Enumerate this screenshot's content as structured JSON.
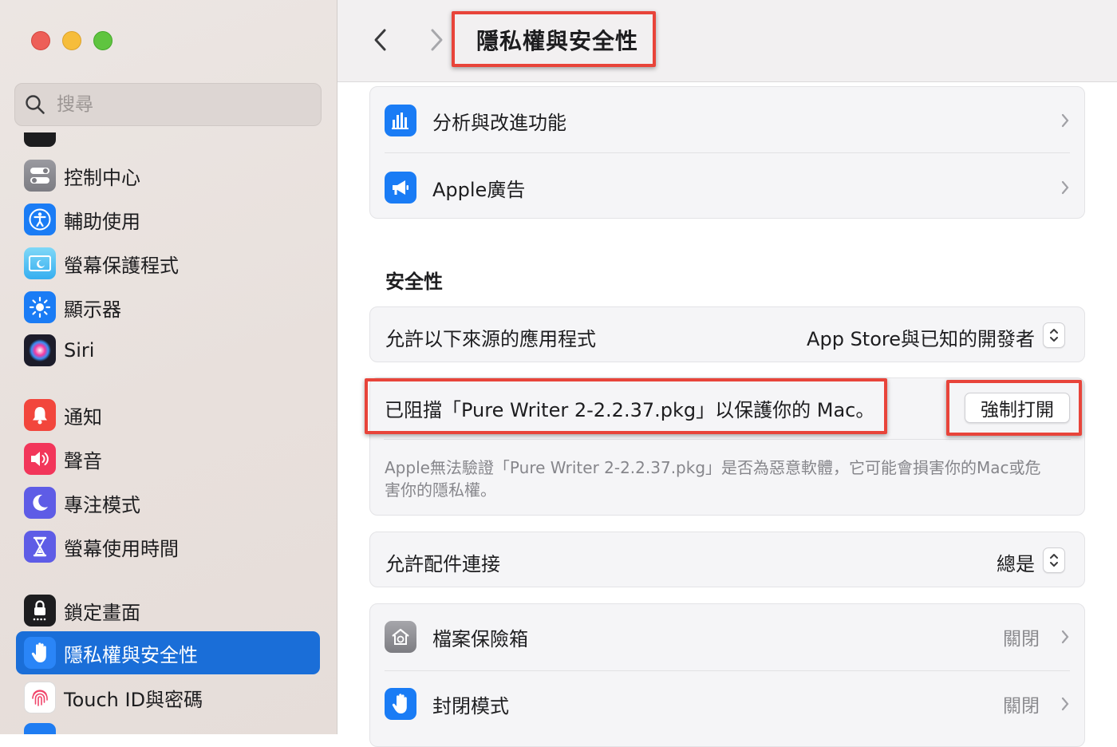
{
  "window": {
    "title": "隱私權與安全性"
  },
  "sidebar": {
    "search": {
      "placeholder": "搜尋"
    },
    "items": [
      {
        "label": "控制中心",
        "icon": "control-center-icon",
        "color": "#8e8e93"
      },
      {
        "label": "輔助使用",
        "icon": "accessibility-icon",
        "color": "#1a7cf5"
      },
      {
        "label": "螢幕保護程式",
        "icon": "screen-saver-icon",
        "color": "#5ac8fa"
      },
      {
        "label": "顯示器",
        "icon": "display-brightness-icon",
        "color": "#1a7cf5"
      },
      {
        "label": "Siri",
        "icon": "siri-icon",
        "color": "#2b2b3a"
      },
      {
        "label": "通知",
        "icon": "notification-bell-icon",
        "color": "#f2463c"
      },
      {
        "label": "聲音",
        "icon": "speaker-icon",
        "color": "#f2365a"
      },
      {
        "label": "專注模式",
        "icon": "moon-icon",
        "color": "#5e5ce6"
      },
      {
        "label": "螢幕使用時間",
        "icon": "hourglass-icon",
        "color": "#5e5ce6"
      },
      {
        "label": "鎖定畫面",
        "icon": "lock-screen-icon",
        "color": "#1d1d1f"
      },
      {
        "label": "隱私權與安全性",
        "icon": "hand-icon",
        "color": "#1a7cf5",
        "active": true
      },
      {
        "label": "Touch ID與密碼",
        "icon": "fingerprint-icon",
        "color": "#ffffff"
      }
    ]
  },
  "main": {
    "rows_top": [
      {
        "label": "分析與改進功能",
        "icon": "analytics-icon",
        "color": "#1a7cf5"
      },
      {
        "label": "Apple廣告",
        "icon": "megaphone-icon",
        "color": "#1a7cf5"
      }
    ],
    "security": {
      "title": "安全性",
      "allow_apps_label": "允許以下來源的應用程式",
      "allow_apps_value": "App Store與已知的開發者",
      "blocked_message": "已阻擋「Pure Writer 2-2.2.37.pkg」以保護你的 Mac。",
      "force_open_button": "強制打開",
      "blocked_description": "Apple無法驗證「Pure Writer 2-2.2.37.pkg」是否為惡意軟體，它可能會損害你的Mac或危害你的隱私權。",
      "accessories_label": "允許配件連接",
      "accessories_value": "總是",
      "filevault_label": "檔案保險箱",
      "filevault_value": "關閉",
      "lockdown_label": "封閉模式",
      "lockdown_value": "關閉"
    }
  },
  "annotation_color": "#e8443a"
}
